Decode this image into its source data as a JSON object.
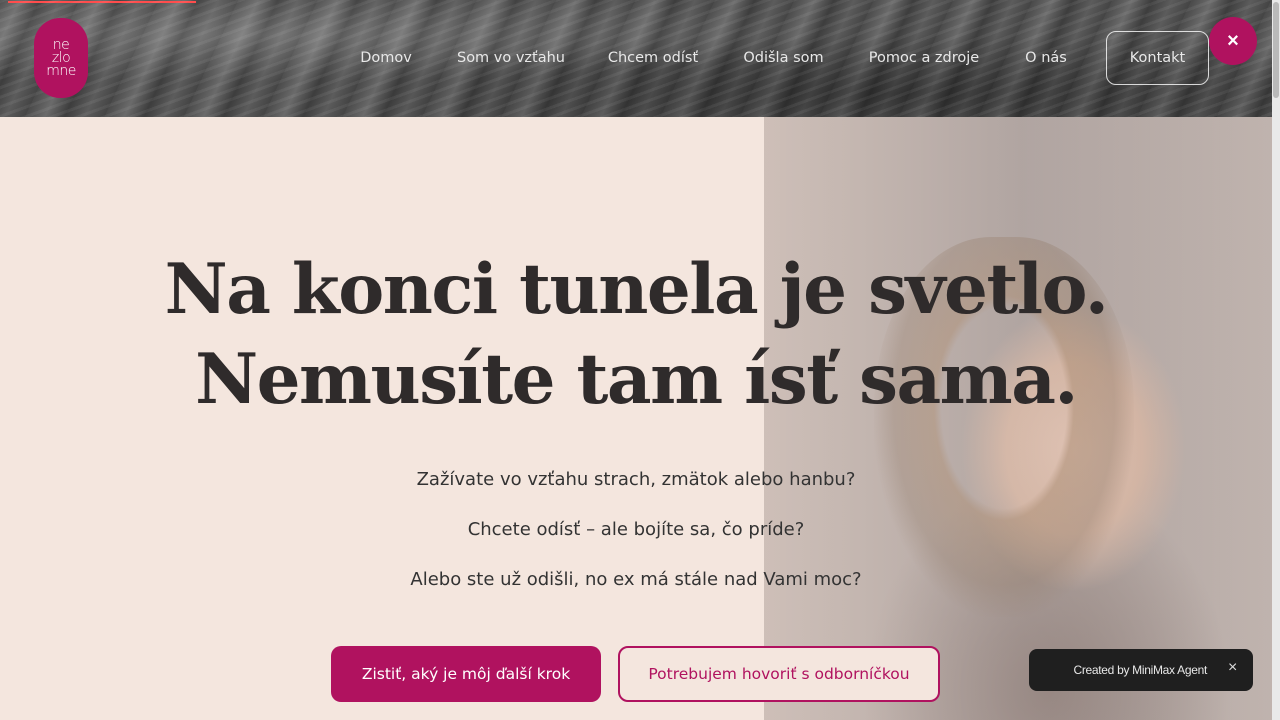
{
  "logo": {
    "text_line1": "ne",
    "text_line2": "zlo",
    "text_line3": "mne"
  },
  "nav": {
    "items": [
      {
        "label": "Domov"
      },
      {
        "label": "Som vo vzťahu"
      },
      {
        "label": "Chcem odísť"
      },
      {
        "label": "Odišla som"
      },
      {
        "label": "Pomoc a zdroje"
      },
      {
        "label": "O nás"
      },
      {
        "label": "Kontakt"
      }
    ]
  },
  "close_button": {
    "icon": "×"
  },
  "hero": {
    "headline_line1": "Na konci tunela je svetlo.",
    "headline_line2": "Nemusíte tam ísť sama.",
    "questions": [
      "Zažívate vo vzťahu strach, zmätok alebo hanbu?",
      "Chcete odísť – ale bojíte sa, čo príde?",
      "Alebo ste už odišli, no ex má stále nad Vami moc?"
    ],
    "primary_cta": "Zistiť, aký je môj ďalší krok",
    "secondary_cta": "Potrebujem hovoriť s odborníčkou"
  },
  "toast": {
    "text": "Created by MiniMax Agent",
    "close": "×"
  },
  "colors": {
    "brand": "#b0125f",
    "background": "#f4e6de",
    "text": "#2f2b2b"
  }
}
